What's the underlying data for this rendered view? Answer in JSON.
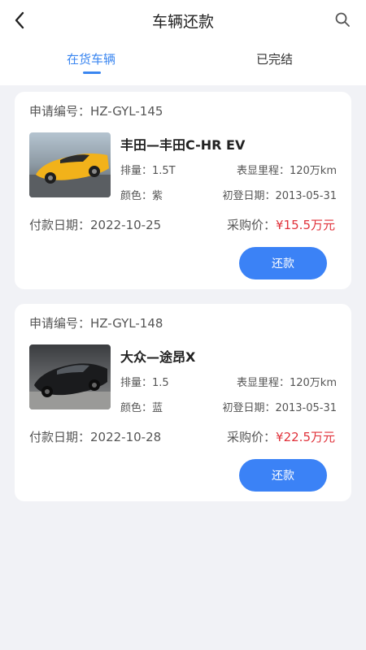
{
  "header": {
    "title": "车辆还款",
    "back_icon": "chevron-left-icon",
    "search_icon": "search-icon"
  },
  "tabs": [
    {
      "label": "在货车辆",
      "active": true
    },
    {
      "label": "已完结",
      "active": false
    }
  ],
  "colors": {
    "accent": "#3a86f0",
    "button": "#3b82f6",
    "price": "#e0313a",
    "background": "#f1f2f6"
  },
  "cards": [
    {
      "application_no": "申请编号：HZ-GYL-145",
      "car_name": "丰田—丰田C-HR EV",
      "displacement": "排量：1.5T",
      "mileage": "表显里程：120万km",
      "color": "颜色：紫",
      "first_registration": "初登日期：2013-05-31",
      "payment_date": "付款日期：2022-10-25",
      "price_label": "采购价：",
      "price": "¥15.5万元",
      "button_label": "还款"
    },
    {
      "application_no": "申请编号：HZ-GYL-148",
      "car_name": "大众—途昂X",
      "displacement": "排量：1.5",
      "mileage": "表显里程：120万km",
      "color": "颜色：蓝",
      "first_registration": "初登日期：2013-05-31",
      "payment_date": "付款日期：2022-10-28",
      "price_label": "采购价：",
      "price": "¥22.5万元",
      "button_label": "还款"
    }
  ]
}
